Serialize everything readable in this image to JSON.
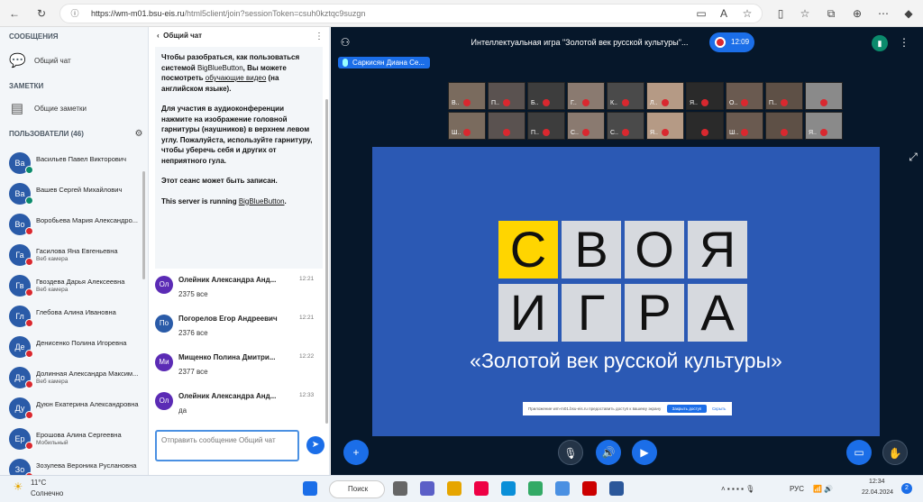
{
  "browser": {
    "url_domain": "https://wm-m01.bsu-eis.ru",
    "url_path": "/html5client/join?sessionToken=csuh0kztqc9suzgn"
  },
  "sidebar": {
    "messages_heading": "СООБЩЕНИЯ",
    "public_chat": "Общий чат",
    "notes_heading": "ЗАМЕТКИ",
    "shared_notes": "Общие заметки",
    "users_heading": "ПОЛЬЗОВАТЕЛИ (46)",
    "users": [
      {
        "initials": "Ва",
        "name": "Васильев Павел Викторович",
        "sub": "",
        "mic": "g"
      },
      {
        "initials": "Ва",
        "name": "Вашев Сергей Михайлович",
        "sub": "",
        "mic": "g"
      },
      {
        "initials": "Во",
        "name": "Воробьева Мария Александро...",
        "sub": "",
        "mic": "r"
      },
      {
        "initials": "Га",
        "name": "Гасилова Яна Евгеньевна",
        "sub": "Веб камера",
        "mic": "r"
      },
      {
        "initials": "Гв",
        "name": "Гвоздева Дарья Алексеевна",
        "sub": "Веб камера",
        "mic": "r"
      },
      {
        "initials": "Гл",
        "name": "Глебова Алина Ивановна",
        "sub": "",
        "mic": "r"
      },
      {
        "initials": "Де",
        "name": "Денисенко Полина Игоревна",
        "sub": "",
        "mic": "r"
      },
      {
        "initials": "До",
        "name": "Долинная Александра Максим...",
        "sub": "Веб камера",
        "mic": "r"
      },
      {
        "initials": "Ду",
        "name": "Дуюн Екатерина Александровна",
        "sub": "",
        "mic": "r"
      },
      {
        "initials": "Ер",
        "name": "Ерошова Алина Сергеевна",
        "sub": "Мобильный",
        "mic": "r"
      },
      {
        "initials": "Зо",
        "name": "Зозулева Вероника Руслановна",
        "sub": "",
        "mic": "r"
      }
    ]
  },
  "chat": {
    "header": "Общий чат",
    "welcome_1": "Чтобы разобраться, как пользоваться системой",
    "welcome_2": "BigBlueButton",
    "welcome_3": ", Вы можете посмотреть",
    "welcome_4": "обучающие видео",
    "welcome_5": " (на английском языке).",
    "welcome_6": "Для участия в аудиоконференции нажмите на изображение головной гарнитуры (наушников) в верхнем левом углу.",
    "welcome_7": " Пожалуйста, используйте гарнитуру, чтобы уберечь себя и других от неприятного гула.",
    "welcome_8": "Этот сеанс может быть записан.",
    "welcome_9": "This server is running ",
    "welcome_10": "BigBlueButton",
    "welcome_11": ".",
    "messages": [
      {
        "initials": "Ол",
        "name": "Олейник Александра Анд...",
        "time": "12:21",
        "text": "2375 все",
        "color": "#5b2bb5"
      },
      {
        "initials": "По",
        "name": "Погорелов Егор Андреевич",
        "time": "12:21",
        "text": "2376 все",
        "color": "#2a5ba8"
      },
      {
        "initials": "Ми",
        "name": "Мищенко Полина Дмитри...",
        "time": "12:22",
        "text": "2377 все",
        "color": "#5b2bb5"
      },
      {
        "initials": "Ол",
        "name": "Олейник Александра Анд...",
        "time": "12:33",
        "text": "да",
        "color": "#5b2bb5"
      }
    ],
    "input_placeholder": "Отправить сообщение Общий чат"
  },
  "main": {
    "title": "Интеллектуальная игра \"Золотой век русской культуры\"...",
    "record_time": "12:09",
    "talking": "Саркисян Диана Се...",
    "tiles": [
      "В..",
      "П..",
      "Б..",
      "Г..",
      "К..",
      "Л..",
      "Я..",
      "О..",
      "П..",
      "",
      "Ш..",
      "",
      "П..",
      "С..",
      "С..",
      "Я..",
      "",
      "Ш..",
      "",
      "Я.."
    ],
    "slide": {
      "row1": [
        "С",
        "В",
        "О",
        "Я"
      ],
      "row2": [
        "И",
        "Г",
        "Р",
        "А"
      ],
      "subtitle": "«Золотой век русской культуры»",
      "notice_text": "Приложение wm-m01.bsu-eis.ru предоставить доступ к вашему экрану",
      "notice_btn": "Закрыть доступ",
      "notice_hide": "Скрыть"
    }
  },
  "taskbar": {
    "weather_temp": "11°C",
    "weather_desc": "Солнечно",
    "search": "Поиск",
    "lang": "РУС",
    "time": "12:34",
    "date": "22.04.2024",
    "badge": "2"
  },
  "colors": {
    "accent": "#1b6ee8",
    "slide_bg": "#2b59b4",
    "main_bg": "#06172a",
    "yellow": "#ffd500"
  }
}
